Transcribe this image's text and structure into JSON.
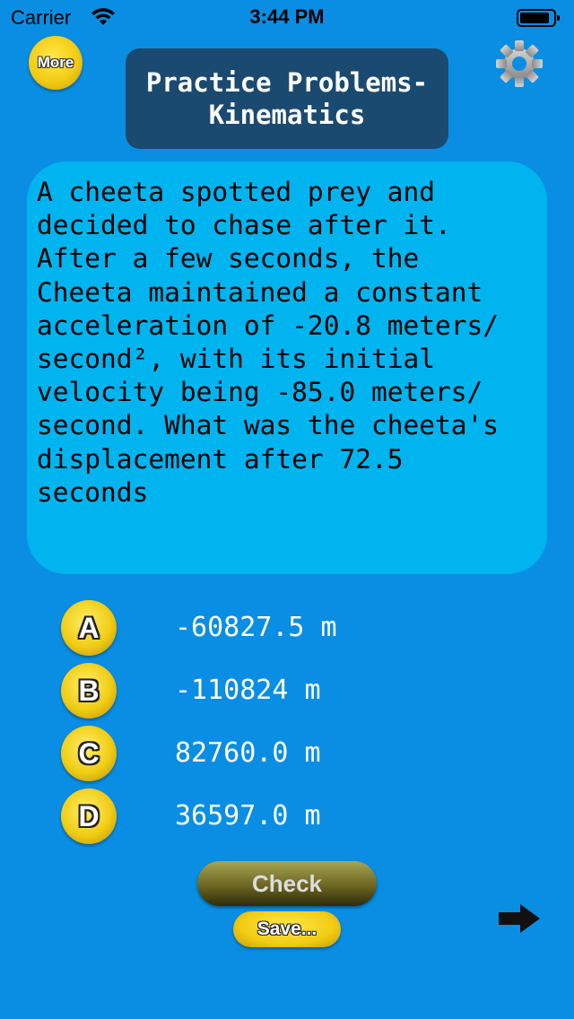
{
  "status_bar": {
    "carrier": "Carrier",
    "time": "3:44 PM",
    "icons": [
      "wifi-icon",
      "battery-icon"
    ]
  },
  "header": {
    "more_label": "More",
    "title": "Practice Problems-\nKinematics",
    "settings_icon": "gear-icon"
  },
  "question": {
    "text": "A cheeta spotted prey and\ndecided to chase after it.\nAfter a few seconds, the\nCheeta maintained a constant\nacceleration of -20.8 meters/\nsecond², with its initial\nvelocity being -85.0 meters/\nsecond. What was the cheeta's\ndisplacement after 72.5\nseconds"
  },
  "choices": [
    {
      "letter": "A",
      "value": "-60827.5 m"
    },
    {
      "letter": "B",
      "value": "-110824 m"
    },
    {
      "letter": "C",
      "value": "82760.0 m"
    },
    {
      "letter": "D",
      "value": "36597.0 m"
    }
  ],
  "actions": {
    "check_label": "Check",
    "save_label": "Save...",
    "next_icon": "arrow-right-icon"
  },
  "colors": {
    "background": "#0a8ee3",
    "question_box": "#00b4ef",
    "title_box": "#1b4a70",
    "accent_yellow": "#f2cc14"
  }
}
